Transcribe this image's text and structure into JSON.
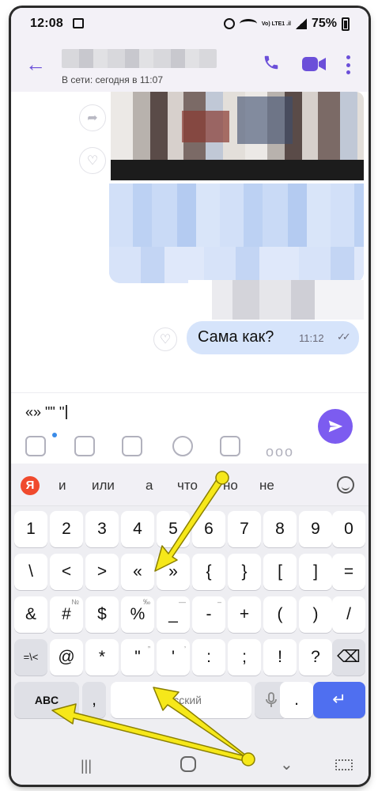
{
  "status": {
    "time": "12:08",
    "battery": "75%",
    "lte": "Vo) LTE1 .il"
  },
  "header": {
    "presence": "В сети: сегодня в 11:07"
  },
  "messages": [
    {
      "text": "Сама как?",
      "time": "11:12"
    }
  ],
  "composer": {
    "text": "«» \"\" ''"
  },
  "suggestions": [
    "и",
    "или",
    "а",
    "что",
    "но",
    "не"
  ],
  "keyboard": {
    "row1": [
      "1",
      "2",
      "3",
      "4",
      "5",
      "6",
      "7",
      "8",
      "9",
      "0"
    ],
    "row2": [
      "\\",
      "<",
      ">",
      "«",
      "»",
      "{",
      "}",
      "[",
      "]",
      "="
    ],
    "row2_sub": [
      "",
      "",
      "",
      "",
      "",
      "",
      "",
      "",
      "",
      ""
    ],
    "row3": [
      "&",
      "#",
      "$",
      "%",
      "_",
      "-",
      "+",
      "(",
      ")",
      "/"
    ],
    "row3_sub": [
      "",
      "№",
      "",
      "‰",
      "—",
      "–",
      "",
      "",
      "",
      ""
    ],
    "row4": [
      "=\\<",
      "@",
      "*",
      "\"",
      "'",
      ":",
      ";",
      "!",
      "?"
    ],
    "row4_sub": [
      "",
      "",
      "",
      "„",
      "‚",
      "",
      "",
      "",
      "",
      ""
    ],
    "abc_label": "ABC",
    "space_label": "Русский",
    "comma": ",",
    "period": "."
  },
  "colors": {
    "accent": "#6b4fd9",
    "send": "#7c5cf0",
    "bubble_out": "#d6e4fb",
    "enter": "#4f6ff0",
    "arrow": "#f6e81a"
  }
}
